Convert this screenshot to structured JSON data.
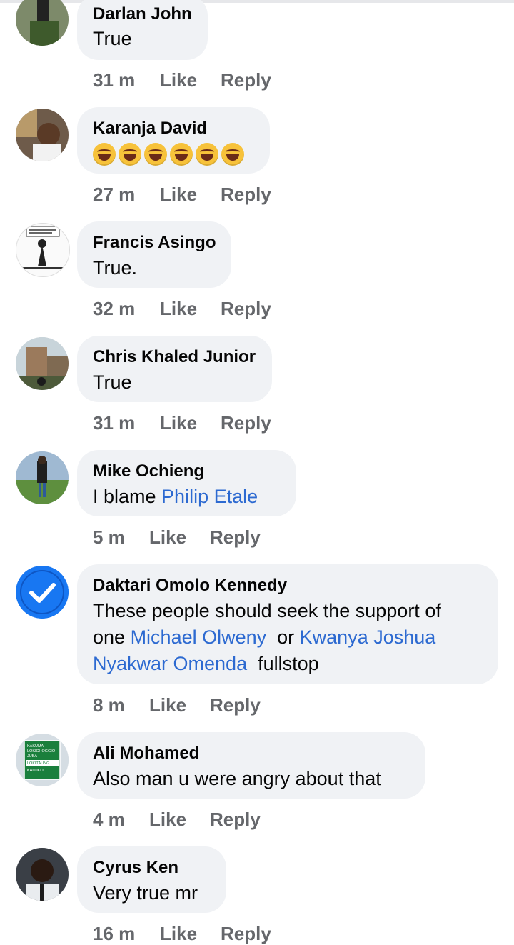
{
  "comments": [
    {
      "name": "Darlan John",
      "text": "True",
      "time": "31 m"
    },
    {
      "name": "Karanja David",
      "emoji_count": 6,
      "time": "27 m"
    },
    {
      "name": "Francis Asingo",
      "text": "True.",
      "time": "32 m",
      "avatar_text": "Welcome to TANGATANGA you won't need this!"
    },
    {
      "name": "Chris Khaled Junior",
      "text": "True",
      "time": "31 m"
    },
    {
      "name": "Mike Ochieng",
      "text": "I blame ",
      "mention": "Philip Etale",
      "time": "5 m"
    },
    {
      "name": "Daktari Omolo Kennedy",
      "line1": "These people should seek the support of",
      "line2_prefix": "one ",
      "mention1": "Michael Olweny",
      "line2_mid": "  or ",
      "mention2": "Kwanya Joshua",
      "mention2b": "Nyakwar Omenda",
      "line3_suffix": "  fullstop",
      "time": "8 m"
    },
    {
      "name": "Ali Mohamed",
      "text": "Also man u were angry about that",
      "time": "4 m",
      "sign_lines": [
        "KAKUMA",
        "LOKICHOGGIO",
        "JUBA",
        "LOKITAUNG",
        "KALOKOL"
      ]
    },
    {
      "name": "Cyrus Ken",
      "text": "Very true mr",
      "time": "16 m"
    }
  ],
  "actions": {
    "like": "Like",
    "reply": "Reply"
  },
  "colors": {
    "bubble": "#f0f2f5",
    "link": "#2d6ad1",
    "meta": "#65676b",
    "verified": "#1877f2"
  }
}
